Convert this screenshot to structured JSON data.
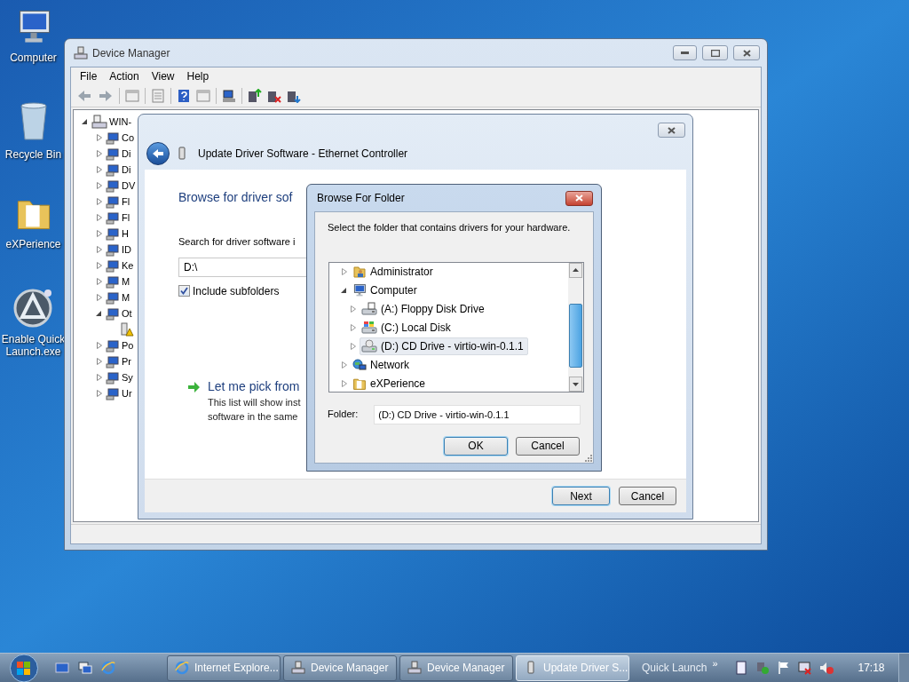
{
  "desktop_icons": [
    {
      "label": "Computer",
      "kind": "computer"
    },
    {
      "label": "Recycle Bin",
      "kind": "recycle-bin"
    },
    {
      "label": "eXPerience",
      "kind": "folder"
    },
    {
      "label": "Enable Quick Launch.exe",
      "kind": "app"
    }
  ],
  "device_manager": {
    "title": "Device Manager",
    "menu": [
      "File",
      "Action",
      "View",
      "Help"
    ],
    "tree": {
      "label": "WIN-",
      "expanded": true,
      "children": [
        {
          "label": "Co",
          "expanded": false
        },
        {
          "label": "Di",
          "expanded": false
        },
        {
          "label": "Di",
          "expanded": false
        },
        {
          "label": "DV",
          "expanded": false
        },
        {
          "label": "Fl",
          "expanded": false
        },
        {
          "label": "Fl",
          "expanded": false
        },
        {
          "label": "H",
          "expanded": false
        },
        {
          "label": "ID",
          "expanded": false
        },
        {
          "label": "Ke",
          "expanded": false
        },
        {
          "label": "M",
          "expanded": false
        },
        {
          "label": "M",
          "expanded": false
        },
        {
          "label": "Ot",
          "expanded": true,
          "children": [
            {
              "warning": true
            }
          ]
        },
        {
          "label": "Po",
          "expanded": false
        },
        {
          "label": "Pr",
          "expanded": false
        },
        {
          "label": "Sy",
          "expanded": false
        },
        {
          "label": "Ur",
          "expanded": false
        }
      ]
    }
  },
  "update_driver": {
    "title": "Update Driver Software - Ethernet Controller",
    "heading": "Browse for driver sof",
    "search_label": "Search for driver software i",
    "path": "D:\\",
    "include_subfolders": {
      "label": "Include subfolders",
      "checked": true
    },
    "pick_link": "Let me pick from",
    "pick_description": [
      "This list will show inst",
      "software in the same"
    ],
    "buttons": [
      {
        "label": "Next",
        "default": true
      },
      {
        "label": "Cancel",
        "default": false
      }
    ]
  },
  "browse_folder": {
    "title": "Browse For Folder",
    "instruction": "Select the folder that contains drivers for your hardware.",
    "tree": [
      {
        "label": "Administrator",
        "kind": "user-folder",
        "expanded": false,
        "selected": false
      },
      {
        "label": "Computer",
        "kind": "computer",
        "expanded": true,
        "selected": false,
        "children": [
          {
            "label": "(A:) Floppy Disk Drive",
            "kind": "floppy",
            "expanded": false,
            "selected": false
          },
          {
            "label": "(C:) Local Disk",
            "kind": "system-drive",
            "expanded": false,
            "selected": false
          },
          {
            "label": "(D:) CD Drive - virtio-win-0.1.1",
            "kind": "cd-drive",
            "expanded": false,
            "selected": true
          }
        ]
      },
      {
        "label": "Network",
        "kind": "network",
        "expanded": false,
        "selected": false
      },
      {
        "label": "eXPerience",
        "kind": "folder",
        "expanded": false,
        "selected": false
      }
    ],
    "folder_label": "Folder:",
    "folder_value": "(D:) CD Drive - virtio-win-0.1.1",
    "buttons": [
      {
        "label": "OK",
        "default": true
      },
      {
        "label": "Cancel",
        "default": false
      }
    ]
  },
  "taskbar": {
    "tasks": [
      {
        "label": "Internet Explore...",
        "kind": "browser",
        "selected": false
      },
      {
        "label": "Device Manager",
        "kind": "device-manager",
        "selected": false
      },
      {
        "label": "Device Manager",
        "kind": "device-manager",
        "selected": false
      },
      {
        "label": "Update Driver S...",
        "kind": "driver",
        "selected": true
      }
    ],
    "toolbar_label": "Quick Launch",
    "overflow": "»",
    "clock": "17:18"
  }
}
